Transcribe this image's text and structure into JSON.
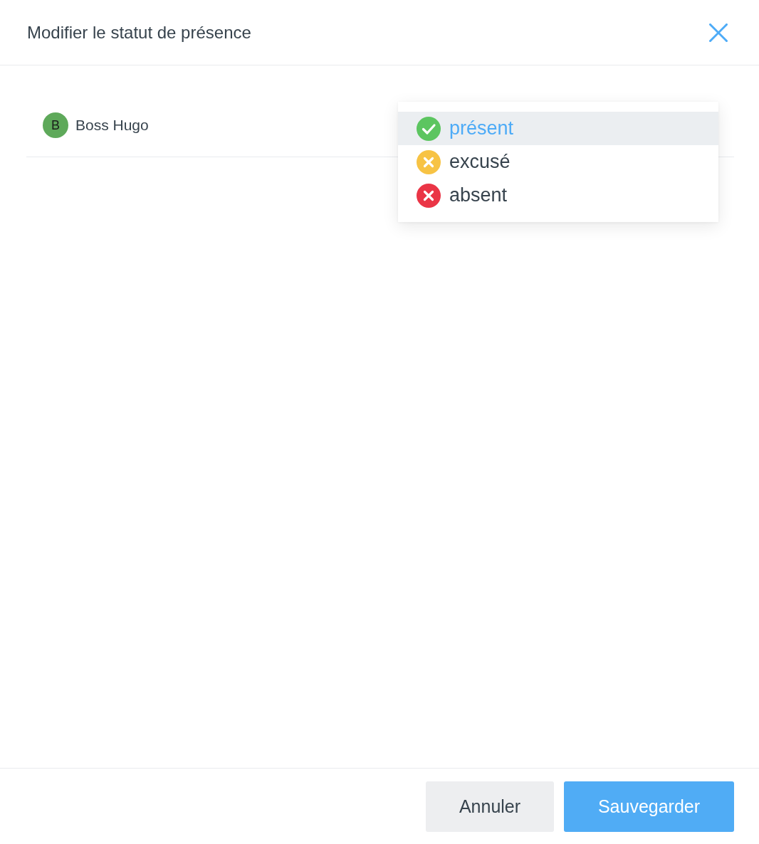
{
  "dialog": {
    "title": "Modifier le statut de présence"
  },
  "attendee": {
    "initial": "B",
    "name": "Boss Hugo"
  },
  "status_menu": {
    "options": [
      {
        "kind": "present",
        "label": "présent",
        "color": "#5cc560",
        "selected": true
      },
      {
        "kind": "excused",
        "label": "excusé",
        "color": "#f7c344",
        "selected": false
      },
      {
        "kind": "absent",
        "label": "absent",
        "color": "#ea3546",
        "selected": false
      }
    ]
  },
  "buttons": [
    {
      "kind": "secondary",
      "label": "Annuler"
    },
    {
      "kind": "primary",
      "label": "Sauvegarder"
    }
  ]
}
